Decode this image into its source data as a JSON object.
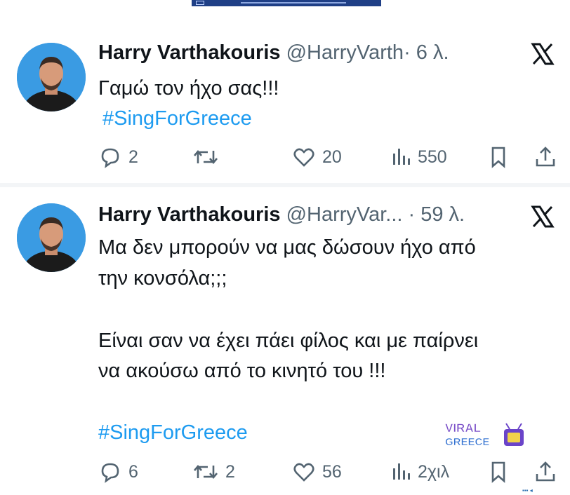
{
  "tweets": [
    {
      "name": "Harry Varthakouris",
      "handle": "@HarryVarth",
      "time": "· 6 λ.",
      "text": "Γαμώ τον ήχο σας!!!",
      "hashtag": "#SingForGreece",
      "replies": "2",
      "retweets": "",
      "likes": "20",
      "views": "550"
    },
    {
      "name": "Harry Varthakouris",
      "handle": "@HarryVar...",
      "time": "· 59 λ.",
      "text_lines": [
        "Μα δεν μπορούν να μας δώσουν ήχο από",
        "την κονσόλα;;;",
        "Είναι σαν να έχει πάει φίλος και με παίρνει",
        "να ακούσω από το κινητό του !!!"
      ],
      "hashtag": "#SingForGreece",
      "replies": "6",
      "retweets": "2",
      "likes": "56",
      "views": "2χιλ"
    }
  ],
  "watermark": {
    "line1": "VIRAL",
    "line2": "GREECE"
  },
  "colors": {
    "text": "#0f1419",
    "secondary": "#536471",
    "link": "#1d9bf0",
    "avatar_bg": "#3a9be3"
  },
  "icons": [
    "x-logo-icon",
    "reply-icon",
    "retweet-icon",
    "like-icon",
    "views-icon",
    "bookmark-icon",
    "share-icon"
  ]
}
